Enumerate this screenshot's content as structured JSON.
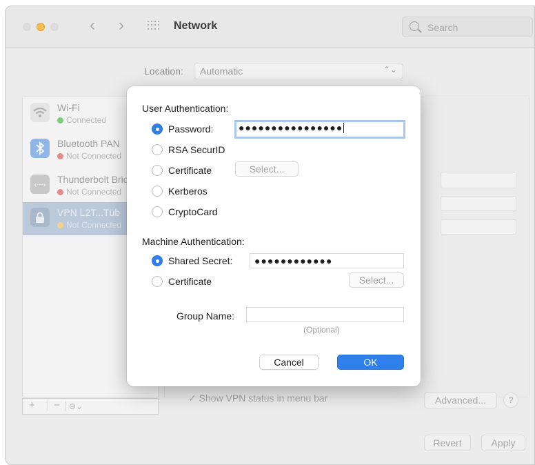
{
  "window": {
    "title": "Network",
    "search_placeholder": "Search",
    "nav_back": "‹",
    "nav_forward": "›"
  },
  "location": {
    "label": "Location:",
    "value": "Automatic"
  },
  "services": [
    {
      "name": "Wi-Fi",
      "status": "Connected",
      "status_color": "#7ccf7a",
      "icon": "wifi-icon"
    },
    {
      "name": "Bluetooth PAN",
      "status": "Not Connected",
      "status_color": "#e58a8a",
      "icon": "bluetooth-icon"
    },
    {
      "name": "Thunderbolt Bridge",
      "status": "Not Connected",
      "status_color": "#e58a8a",
      "icon": "thunderbolt-icon"
    },
    {
      "name": "VPN L2T...Tüb",
      "status": "Not Connected",
      "status_color": "#f0d48a",
      "icon": "lock-icon"
    }
  ],
  "sidebar_tools": {
    "add": "+",
    "remove": "−",
    "more": "⊝⌄"
  },
  "background": {
    "show_vpn_status": "✓  Show VPN status in menu bar",
    "advanced_button": "Advanced...",
    "help_button": "?",
    "revert_button": "Revert",
    "apply_button": "Apply"
  },
  "dialog": {
    "user_auth_title": "User Authentication:",
    "user_options": [
      {
        "label": "Password:",
        "selected": true
      },
      {
        "label": "RSA SecurID",
        "selected": false
      },
      {
        "label": "Certificate",
        "selected": false
      },
      {
        "label": "Kerberos",
        "selected": false
      },
      {
        "label": "CryptoCard",
        "selected": false
      }
    ],
    "password_value": "●●●●●●●●●●●●●●●●",
    "user_cert_select": "Select...",
    "machine_auth_title": "Machine Authentication:",
    "machine_options": [
      {
        "label": "Shared Secret:",
        "selected": true
      },
      {
        "label": "Certificate",
        "selected": false
      }
    ],
    "shared_secret_value": "●●●●●●●●●●●●",
    "machine_cert_select": "Select...",
    "group_name_label": "Group Name:",
    "group_name_value": "",
    "group_name_hint": "(Optional)",
    "cancel_button": "Cancel",
    "ok_button": "OK"
  },
  "colors": {
    "accent": "#2f80ed",
    "focus_ring": "#a9c6ee"
  }
}
